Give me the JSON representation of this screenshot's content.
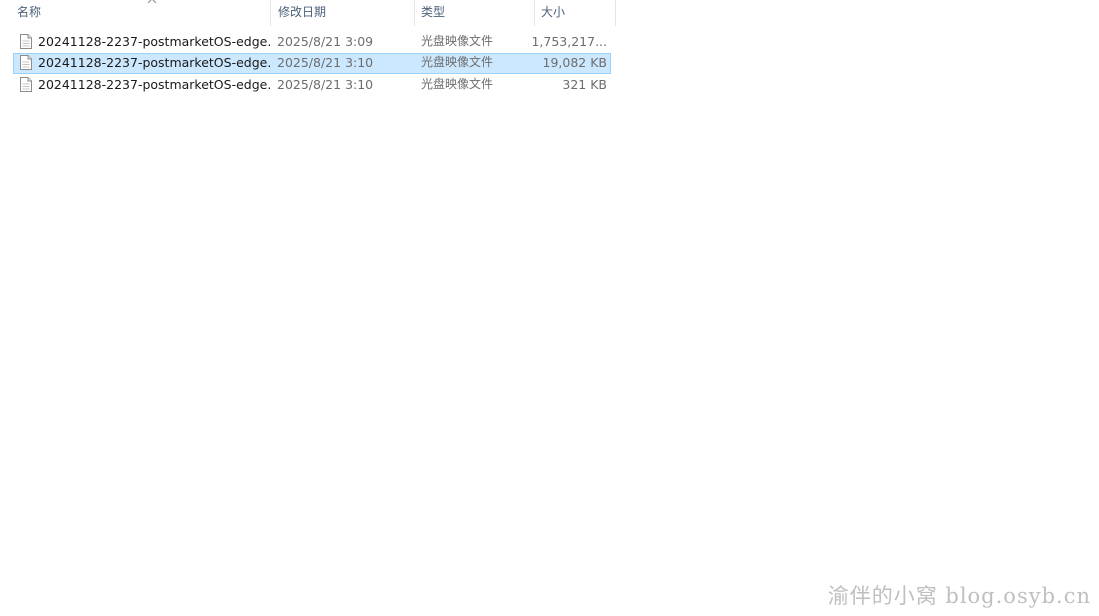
{
  "columns": {
    "name": "名称",
    "date": "修改日期",
    "type": "类型",
    "size": "大小"
  },
  "files": [
    {
      "name": "20241128-2237-postmarketOS-edge...",
      "date": "2025/8/21 3:09",
      "type": "光盘映像文件",
      "size": "1,753,217...",
      "selected": false
    },
    {
      "name": "20241128-2237-postmarketOS-edge...",
      "date": "2025/8/21 3:10",
      "type": "光盘映像文件",
      "size": "19,082 KB",
      "selected": true
    },
    {
      "name": "20241128-2237-postmarketOS-edge...",
      "date": "2025/8/21 3:10",
      "type": "光盘映像文件",
      "size": "321 KB",
      "selected": false
    }
  ],
  "icons": {
    "file": "disc-image-file-icon",
    "sort": "sort-ascending-icon"
  },
  "colors": {
    "selection_bg": "#cce8ff",
    "selection_border": "#99d1ff",
    "header_text": "#4c607a"
  },
  "watermark": "渝伴的小窝 blog.osyb.cn"
}
